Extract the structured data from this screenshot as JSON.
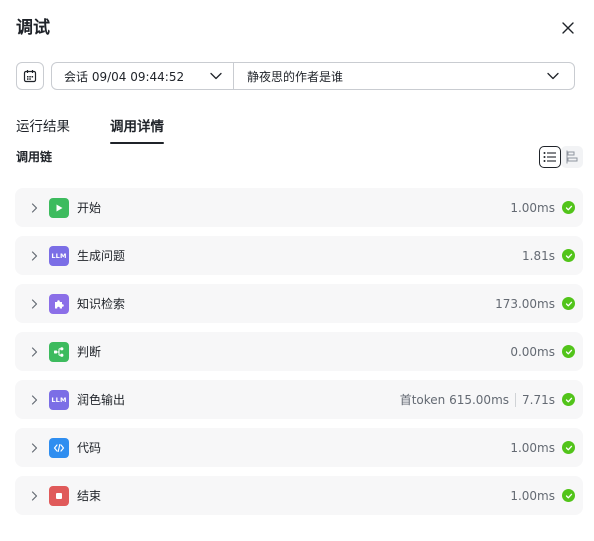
{
  "header": {
    "title": "调试"
  },
  "filters": {
    "session_label": "会话 09/04 09:44:52",
    "query_label": "静夜思的作者是谁"
  },
  "tabs": [
    {
      "label": "运行结果",
      "active": false
    },
    {
      "label": "调用详情",
      "active": true
    }
  ],
  "chain": {
    "title": "调用链",
    "nodes": [
      {
        "name": "开始",
        "icon": "play-icon",
        "icon_color": "#3dbb5e",
        "duration": "1.00ms",
        "status": "success"
      },
      {
        "name": "生成问题",
        "icon": "llm-icon",
        "icon_text": "LLM",
        "icon_color": "#7b6ee6",
        "duration": "1.81s",
        "status": "success"
      },
      {
        "name": "知识检索",
        "icon": "puzzle-icon",
        "icon_color": "#8b6fe8",
        "duration": "173.00ms",
        "status": "success"
      },
      {
        "name": "判断",
        "icon": "branch-icon",
        "icon_color": "#3dbb5e",
        "duration": "0.00ms",
        "status": "success"
      },
      {
        "name": "润色输出",
        "icon": "llm-icon",
        "icon_text": "LLM",
        "icon_color": "#7b6ee6",
        "first_token": "首token 615.00ms",
        "duration": "7.71s",
        "status": "success"
      },
      {
        "name": "代码",
        "icon": "code-icon",
        "icon_color": "#2f8ef0",
        "duration": "1.00ms",
        "status": "success"
      },
      {
        "name": "结束",
        "icon": "stop-icon",
        "icon_color": "#e05a5a",
        "duration": "1.00ms",
        "status": "success"
      }
    ]
  }
}
